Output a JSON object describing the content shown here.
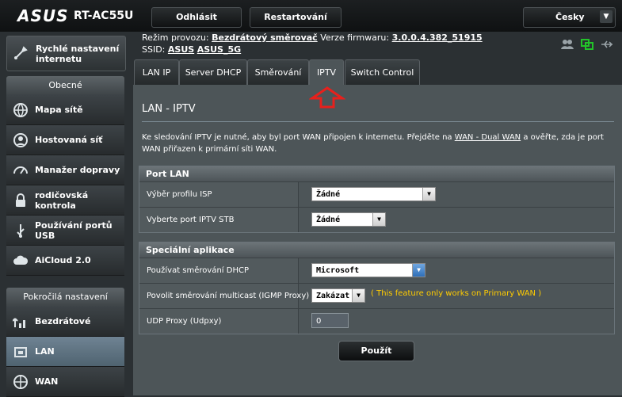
{
  "header": {
    "brand": "ASUS",
    "model": "RT-AC55U",
    "logout_label": "Odhlásit",
    "restart_label": "Restartování",
    "language": "Česky"
  },
  "info": {
    "mode_label": "Režim provozu:",
    "mode_value": "Bezdrátový směrovač",
    "firmware_label": "Verze firmwaru:",
    "firmware_value": "3.0.0.4.382_51915",
    "ssid_label": "SSID:",
    "ssid_1": "ASUS",
    "ssid_2": "ASUS_5G"
  },
  "sidebar": {
    "quick_setup": "Rychlé nastavení internetu",
    "general_header": "Obecné",
    "general_items": [
      {
        "label": "Mapa sítě",
        "icon": "network-map-icon"
      },
      {
        "label": "Hostovaná síť",
        "icon": "guest-network-icon"
      },
      {
        "label": "Manažer dopravy",
        "icon": "traffic-manager-icon"
      },
      {
        "label": "rodičovská kontrola",
        "icon": "parental-control-icon"
      },
      {
        "label": "Používání portů USB",
        "icon": "usb-icon"
      },
      {
        "label": "AiCloud 2.0",
        "icon": "cloud-icon"
      }
    ],
    "advanced_header": "Pokročilá nastavení",
    "advanced_items": [
      {
        "label": "Bezdrátové",
        "icon": "wireless-icon"
      },
      {
        "label": "LAN",
        "icon": "lan-icon",
        "active": true
      },
      {
        "label": "WAN",
        "icon": "wan-icon"
      }
    ]
  },
  "tabs": [
    {
      "label": "LAN IP"
    },
    {
      "label": "Server DHCP"
    },
    {
      "label": "Směrování"
    },
    {
      "label": "IPTV",
      "active": true
    },
    {
      "label": "Switch Control"
    }
  ],
  "main": {
    "title": "LAN - IPTV",
    "desc_part1": "Ke sledování IPTV je nutné, aby byl port WAN připojen k internetu. Přejděte na ",
    "desc_link": "WAN - Dual WAN",
    "desc_part2": " a ověřte, zda je port WAN přiřazen k primární síti WAN.",
    "port_lan": {
      "header": "Port LAN",
      "isp_profile_label": "Výběr profilu ISP",
      "isp_profile_value": "Žádné",
      "iptv_stb_label": "Vyberte port IPTV STB",
      "iptv_stb_value": "Žádné"
    },
    "special_apps": {
      "header": "Speciální aplikace",
      "dhcp_routing_label": "Používat směrování DHCP",
      "dhcp_routing_value": "Microsoft",
      "multicast_label": "Povolit směrování multicast (IGMP Proxy)",
      "multicast_value": "Zakázat",
      "multicast_note": "( This feature only works on Primary WAN )",
      "udp_proxy_label": "UDP Proxy (Udpxy)",
      "udp_proxy_value": "0"
    },
    "apply_label": "Použít"
  },
  "colors": {
    "accent_arrow": "#e8201c",
    "note_text": "#ffcc00",
    "active_menu": "#5f7482"
  }
}
